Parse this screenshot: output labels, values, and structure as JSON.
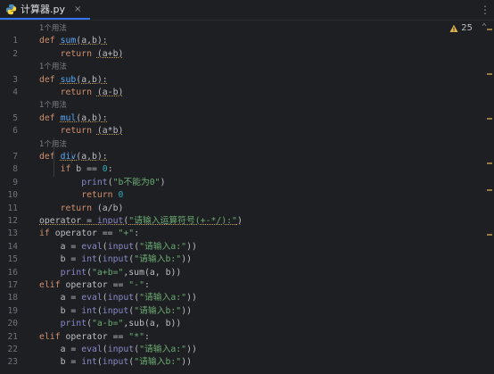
{
  "tab": {
    "filename": "计算器.py",
    "icon": "python-file-icon",
    "close": "×"
  },
  "toolbar": {
    "more": "⋮"
  },
  "inspections": {
    "warning_count": "25",
    "chevron": "⌃"
  },
  "hint_text": "1个用法",
  "lines": [
    {
      "n": "1",
      "tokens": [
        [
          "kw",
          "def "
        ],
        [
          "fn ul",
          "sum"
        ],
        [
          "op ul",
          "(a,b):"
        ]
      ]
    },
    {
      "n": "2",
      "tokens": [
        [
          "op",
          "    "
        ],
        [
          "kw",
          "return "
        ],
        [
          "op ul",
          "(a+b)"
        ]
      ]
    },
    {
      "n": "3",
      "tokens": [
        [
          "kw",
          "def "
        ],
        [
          "fn ul",
          "sub"
        ],
        [
          "op ul",
          "(a,b):"
        ]
      ]
    },
    {
      "n": "4",
      "tokens": [
        [
          "op",
          "    "
        ],
        [
          "kw",
          "return "
        ],
        [
          "op ul",
          "(a-b)"
        ]
      ]
    },
    {
      "n": "5",
      "tokens": [
        [
          "kw",
          "def "
        ],
        [
          "fn ul",
          "mul"
        ],
        [
          "op ul",
          "(a,b):"
        ]
      ]
    },
    {
      "n": "6",
      "tokens": [
        [
          "op",
          "    "
        ],
        [
          "kw",
          "return "
        ],
        [
          "op ul",
          "(a*b)"
        ]
      ]
    },
    {
      "n": "7",
      "tokens": [
        [
          "kw",
          "def "
        ],
        [
          "fn ul",
          "div"
        ],
        [
          "op ul",
          "(a,b):"
        ]
      ]
    },
    {
      "n": "8",
      "tokens": [
        [
          "op",
          "    "
        ],
        [
          "kw",
          "if "
        ],
        [
          "op",
          "b == "
        ],
        [
          "num",
          "0"
        ],
        [
          "op",
          ":"
        ]
      ]
    },
    {
      "n": "9",
      "tokens": [
        [
          "op",
          "        "
        ],
        [
          "bi",
          "print"
        ],
        [
          "op",
          "("
        ],
        [
          "str",
          "\"b不能为0\""
        ],
        [
          "op",
          ")"
        ]
      ]
    },
    {
      "n": "10",
      "tokens": [
        [
          "op",
          "        "
        ],
        [
          "kw",
          "return "
        ],
        [
          "num",
          "0"
        ]
      ]
    },
    {
      "n": "11",
      "tokens": [
        [
          "op",
          "    "
        ],
        [
          "kw",
          "return "
        ],
        [
          "op",
          "(a/b)"
        ]
      ]
    },
    {
      "n": "12",
      "tokens": [
        [
          "op ul",
          "operator = "
        ],
        [
          "bi ul",
          "input"
        ],
        [
          "op ul",
          "("
        ],
        [
          "str ul",
          "\"请输入运算符号(+-*/):\""
        ],
        [
          "op ul",
          ")"
        ]
      ]
    },
    {
      "n": "13",
      "tokens": [
        [
          "kw",
          "if "
        ],
        [
          "op",
          "operator == "
        ],
        [
          "str",
          "\"+\""
        ],
        [
          "op",
          ":"
        ]
      ]
    },
    {
      "n": "14",
      "tokens": [
        [
          "op",
          "    a = "
        ],
        [
          "bi",
          "eval"
        ],
        [
          "op",
          "("
        ],
        [
          "bi",
          "input"
        ],
        [
          "op",
          "("
        ],
        [
          "str",
          "\"请输入a:\""
        ],
        [
          "op",
          "))"
        ]
      ]
    },
    {
      "n": "15",
      "tokens": [
        [
          "op",
          "    b = "
        ],
        [
          "bi",
          "int"
        ],
        [
          "op",
          "("
        ],
        [
          "bi",
          "input"
        ],
        [
          "op",
          "("
        ],
        [
          "str",
          "\"请输入b:\""
        ],
        [
          "op",
          "))"
        ]
      ]
    },
    {
      "n": "16",
      "tokens": [
        [
          "op",
          "    "
        ],
        [
          "bi",
          "print"
        ],
        [
          "op",
          "("
        ],
        [
          "str",
          "\"a+b=\""
        ],
        [
          "op",
          ",sum(a, b))"
        ]
      ]
    },
    {
      "n": "17",
      "tokens": [
        [
          "kw",
          "elif "
        ],
        [
          "op",
          "operator == "
        ],
        [
          "str",
          "\"-\""
        ],
        [
          "op",
          ":"
        ]
      ]
    },
    {
      "n": "18",
      "tokens": [
        [
          "op",
          "    a = "
        ],
        [
          "bi",
          "eval"
        ],
        [
          "op",
          "("
        ],
        [
          "bi",
          "input"
        ],
        [
          "op",
          "("
        ],
        [
          "str",
          "\"请输入a:\""
        ],
        [
          "op",
          "))"
        ]
      ]
    },
    {
      "n": "19",
      "tokens": [
        [
          "op",
          "    b = "
        ],
        [
          "bi",
          "int"
        ],
        [
          "op",
          "("
        ],
        [
          "bi",
          "input"
        ],
        [
          "op",
          "("
        ],
        [
          "str",
          "\"请输入b:\""
        ],
        [
          "op",
          "))"
        ]
      ]
    },
    {
      "n": "20",
      "tokens": [
        [
          "op",
          "    "
        ],
        [
          "bi",
          "print"
        ],
        [
          "op",
          "("
        ],
        [
          "str",
          "\"a-b=\""
        ],
        [
          "op",
          ",sub(a, b))"
        ]
      ]
    },
    {
      "n": "21",
      "tokens": [
        [
          "kw",
          "elif "
        ],
        [
          "op",
          "operator == "
        ],
        [
          "str",
          "\"*\""
        ],
        [
          "op",
          ":"
        ]
      ]
    },
    {
      "n": "22",
      "tokens": [
        [
          "op",
          "    a = "
        ],
        [
          "bi",
          "eval"
        ],
        [
          "op",
          "("
        ],
        [
          "bi",
          "input"
        ],
        [
          "op",
          "("
        ],
        [
          "str",
          "\"请输入a:\""
        ],
        [
          "op",
          "))"
        ]
      ]
    },
    {
      "n": "23",
      "tokens": [
        [
          "op",
          "    b = "
        ],
        [
          "bi",
          "int"
        ],
        [
          "op",
          "("
        ],
        [
          "bi",
          "input"
        ],
        [
          "op",
          "("
        ],
        [
          "str",
          "\"请输入b:\""
        ],
        [
          "op",
          "))"
        ]
      ]
    }
  ],
  "colors": {
    "background": "#1e1f22",
    "keyword": "#cf8e6d",
    "function": "#56a8f5",
    "builtin": "#8888c6",
    "string": "#6aab73",
    "number": "#2aacb8",
    "accent": "#3574f0"
  }
}
